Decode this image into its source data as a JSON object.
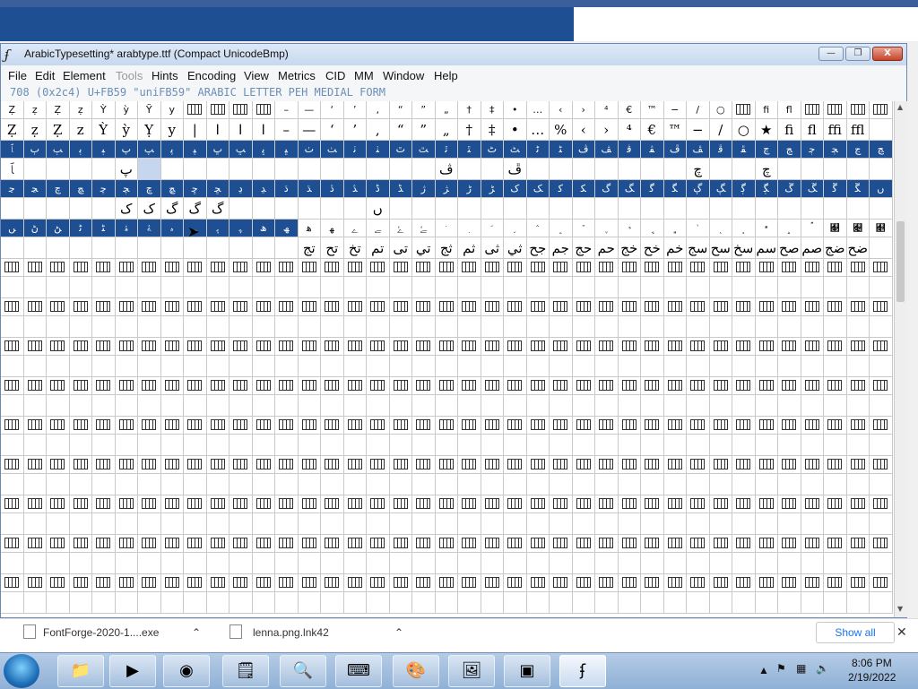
{
  "window": {
    "title": "ArabicTypesetting*  arabtype.ttf (Compact UnicodeBmp)",
    "controls": {
      "minimize": "—",
      "maximize": "❐",
      "close": "X"
    }
  },
  "menu": [
    "File",
    "Edit",
    "Element",
    "Tools",
    "Hints",
    "Encoding",
    "View",
    "Metrics",
    "CID",
    "MM",
    "Window",
    "Help"
  ],
  "disabled_menu": [
    "Tools"
  ],
  "glyph_info": "708 (0x2c4) U+FB59 \"uniFB59\" ARABIC LETTER PEH MEDIAL FORM",
  "grid": {
    "cols": 39,
    "rows": [
      {
        "labels": [
          "Ẓ",
          "ẓ",
          "Ẓ",
          "ẓ",
          "Ỳ",
          "ỳ",
          "Ỹ",
          "y",
          "□",
          "□",
          "□",
          "□",
          "–",
          "—",
          "‘",
          "’",
          "‚",
          "“",
          "”",
          "„",
          "†",
          "‡",
          "•",
          "…",
          "‹",
          "›",
          "⁴",
          "€",
          "™",
          "−",
          "/",
          "○",
          "□",
          "fi",
          "fl",
          "□",
          "□",
          "□",
          "□"
        ],
        "glyphs": [
          "Ẓ",
          "ẓ",
          "Ẓ",
          "z",
          "Ỳ",
          "ỳ",
          "Ỵ",
          "y",
          "|",
          "ا",
          "ا",
          "ا",
          "–",
          "—",
          "‘",
          "’",
          ",",
          "“",
          "”",
          "„",
          "†",
          "‡",
          "•",
          "…",
          "%‰",
          "‹",
          "›",
          "⁴",
          "€",
          "™",
          "−",
          "/",
          "○",
          "★",
          "ﬁ",
          "ﬂ",
          "ﬃ",
          "ﬄ",
          ""
        ]
      },
      {
        "labels": [
          "ﭑ",
          "ﭒ",
          "ﭓ",
          "ﭔ",
          "ﭕ",
          "ﭖ",
          "ﭗ",
          "ﭘ",
          "ﭙ",
          "ﭚ",
          "ﭛ",
          "ﭜ",
          "ﭝ",
          "ﭞ",
          "ﭟ",
          "ﭠ",
          "ﭡ",
          "ﭢ",
          "ﭣ",
          "ﭤ",
          "ﭥ",
          "ﭦ",
          "ﭧ",
          "ﭨ",
          "ﭩ",
          "ﭪ",
          "ﭫ",
          "ﭬ",
          "ﭭ",
          "ﭮ",
          "ﭯ",
          "ﭰ",
          "ﭱ",
          "ﭲ",
          "ﭳ",
          "ﭴ",
          "ﭵ",
          "ﭶ",
          "ﭷ"
        ],
        "glyphs": [
          "ﭑ",
          "",
          "",
          "",
          "",
          "پ",
          "",
          "",
          "",
          "",
          "",
          "",
          "",
          "",
          "",
          "",
          "",
          "",
          "",
          "ڤ",
          "",
          "",
          "ڦ",
          "",
          "",
          "",
          "",
          "",
          "",
          "",
          "چ",
          "",
          "",
          "چ",
          "",
          "",
          "",
          "",
          ""
        ]
      },
      {
        "labels": [
          "ﭸ",
          "ﭹ",
          "ﭺ",
          "ﭻ",
          "ﭼ",
          "ﭽ",
          "ﭾ",
          "ﭿ",
          "ﮀ",
          "ﮁ",
          "ﮂ",
          "ﮃ",
          "ﮄ",
          "ﮅ",
          "ﮆ",
          "ﮇ",
          "ﮈ",
          "ﮉ",
          "ﮊ",
          "ﮋ",
          "ﮌ",
          "ﮍ",
          "ﮎ",
          "ﮏ",
          "ﮐ",
          "ﮑ",
          "ﮒ",
          "ﮓ",
          "ﮔ",
          "ﮕ",
          "ﮖ",
          "ﮗ",
          "ﮘ",
          "ﮙ",
          "ﮚ",
          "ﮛ",
          "ﮜ",
          "ﮝ",
          "ﮞ"
        ],
        "glyphs": [
          "",
          "",
          "",
          "",
          "",
          "ک",
          "ک",
          "گ",
          "گ",
          "گ",
          "",
          "",
          "",
          "",
          "",
          "",
          "ں",
          "",
          "",
          "",
          "",
          "",
          "",
          "",
          "",
          "",
          "",
          "",
          "",
          "",
          "",
          "",
          "",
          "",
          "",
          "",
          "",
          "",
          ""
        ]
      },
      {
        "labels": [
          "ﮟ",
          "ﮠ",
          "ﮡ",
          "ﮢ",
          "ﮣ",
          "ﮤ",
          "ﮥ",
          "ﮦ",
          "ﮧ",
          "ﮨ",
          "ﮩ",
          "ﮪ",
          "ﮫ",
          "ﮬ",
          "ﮭ",
          "ﮮ",
          "ﮯ",
          "ﮰ",
          "ﮱ",
          "﮲",
          "﮳",
          "﮴",
          "﮵",
          "﮶",
          "﮷",
          "﮸",
          "﮹",
          "﮺",
          "﮻",
          "﮼",
          "﮽",
          "﮾",
          "﮿",
          "﯀",
          "﯁",
          "﯂",
          "﯃",
          "﯄",
          "﯅"
        ],
        "glyphs": [
          "",
          "",
          "",
          "",
          "",
          "",
          "",
          "",
          "",
          "",
          "",
          "",
          "",
          "تج",
          "تح",
          "تخ",
          "تم",
          "تى",
          "تي",
          "ثج",
          "ثم",
          "ثى",
          "ثي",
          "جح",
          "جم",
          "حج",
          "حم",
          "خج",
          "خح",
          "خم",
          "سج",
          "سح",
          "سخ",
          "سم",
          "صح",
          "صم",
          "ضج",
          "ضح",
          ""
        ]
      }
    ]
  },
  "downloads": [
    {
      "name": "FontForge-2020-1....exe"
    },
    {
      "name": "lenna.png.lnk42"
    }
  ],
  "download_bar": {
    "show_all": "Show all",
    "close": "✕"
  },
  "taskbar": {
    "time": "8:06 PM",
    "date": "2/19/2022",
    "apps": [
      "folder-icon",
      "media-player-icon",
      "chrome-icon",
      "sticky-notes-icon",
      "magnifier-icon",
      "keyboard-icon",
      "paint-icon",
      "photo-viewer-icon",
      "terminal-icon",
      "fontforge-icon"
    ]
  }
}
